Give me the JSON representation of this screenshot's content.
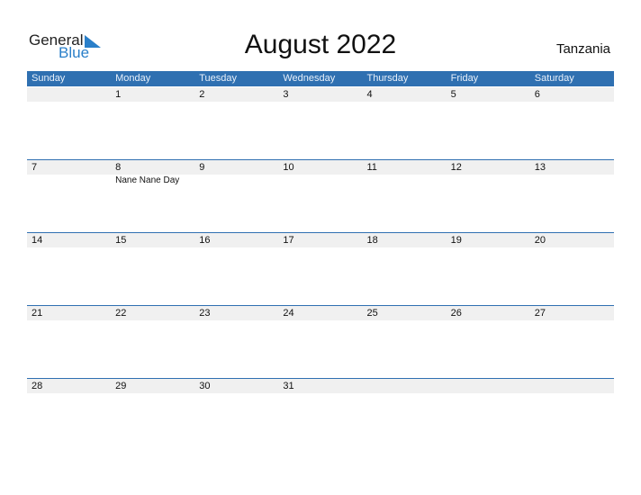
{
  "logo": {
    "general": "General",
    "blue": "Blue"
  },
  "title": "August 2022",
  "country": "Tanzania",
  "colors": {
    "accent": "#2f70b1",
    "strip": "#f0f0f0"
  },
  "days": [
    "Sunday",
    "Monday",
    "Tuesday",
    "Wednesday",
    "Thursday",
    "Friday",
    "Saturday"
  ],
  "weeks": [
    {
      "dates": [
        "",
        "1",
        "2",
        "3",
        "4",
        "5",
        "6"
      ],
      "events": [
        "",
        "",
        "",
        "",
        "",
        "",
        ""
      ]
    },
    {
      "dates": [
        "7",
        "8",
        "9",
        "10",
        "11",
        "12",
        "13"
      ],
      "events": [
        "",
        "Nane Nane Day",
        "",
        "",
        "",
        "",
        ""
      ]
    },
    {
      "dates": [
        "14",
        "15",
        "16",
        "17",
        "18",
        "19",
        "20"
      ],
      "events": [
        "",
        "",
        "",
        "",
        "",
        "",
        ""
      ]
    },
    {
      "dates": [
        "21",
        "22",
        "23",
        "24",
        "25",
        "26",
        "27"
      ],
      "events": [
        "",
        "",
        "",
        "",
        "",
        "",
        ""
      ]
    },
    {
      "dates": [
        "28",
        "29",
        "30",
        "31",
        "",
        "",
        ""
      ],
      "events": [
        "",
        "",
        "",
        "",
        "",
        "",
        ""
      ]
    }
  ]
}
